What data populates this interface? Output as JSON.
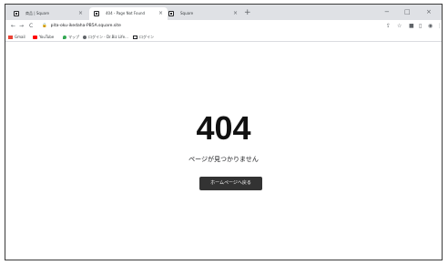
{
  "tabs": [
    {
      "label": "商品 | Square",
      "active": false
    },
    {
      "label": "404 - Page Not Found",
      "active": true
    },
    {
      "label": "Square",
      "active": false
    }
  ],
  "tab_close": "×",
  "new_tab": "+",
  "window_controls": {
    "minimize": "−",
    "maximize": "□",
    "close": "×"
  },
  "toolbar": {
    "back": "←",
    "forward": "→",
    "reload": "C",
    "url": "pita-oku-ikedaha-PB5A.square.site",
    "lock_icon": "lock-icon"
  },
  "bookmarks": [
    {
      "label": "Gmail",
      "icon": "gmail-icon",
      "color": "#ea4335"
    },
    {
      "label": "YouTube",
      "icon": "youtube-icon",
      "color": "#ff0000"
    },
    {
      "label": "マップ",
      "icon": "maps-icon",
      "color": "#34a853"
    },
    {
      "label": "ログイン - Dr.Biz Life...",
      "icon": "globe-icon",
      "color": "#5f6368"
    },
    {
      "label": "ログイン",
      "icon": "square-icon",
      "color": "#202124"
    }
  ],
  "page": {
    "code": "404",
    "message": "ページが見つかりません",
    "home_button": "ホームページへ戻る"
  }
}
